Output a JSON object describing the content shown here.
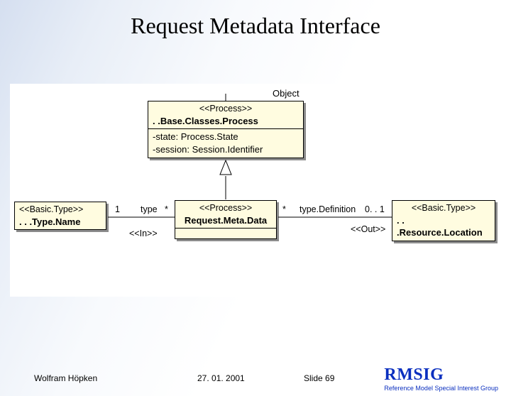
{
  "title": "Request Metadata Interface",
  "diagram": {
    "object_label": "Object",
    "process_box": {
      "stereo": "<<Process>>",
      "name": ". .Base.Classes.Process",
      "attrs": [
        "-state: Process.State",
        "-session: Session.Identifier"
      ]
    },
    "typename_box": {
      "stereo": "<<Basic.Type>>",
      "name": ". . .Type.Name"
    },
    "requestmeta_box": {
      "stereo": "<<Process>>",
      "name": "Request.Meta.Data"
    },
    "resourceloc_box": {
      "stereo": "<<Basic.Type>>",
      "name": ". . .Resource.Location"
    },
    "labels": {
      "left_mult_1": "1",
      "left_role_type": "type",
      "left_mult_star": "*",
      "in_stereo": "<<In>>",
      "right_mult_star": "*",
      "right_role": "type.Definition",
      "right_mult_range": "0. . 1",
      "out_stereo": "<<Out>>"
    }
  },
  "footer": {
    "author": "Wolfram Höpken",
    "date": "27. 01. 2001",
    "slide": "Slide 69",
    "brand_logo": "RMSIG",
    "brand_sub": "Reference Model Special Interest Group"
  }
}
